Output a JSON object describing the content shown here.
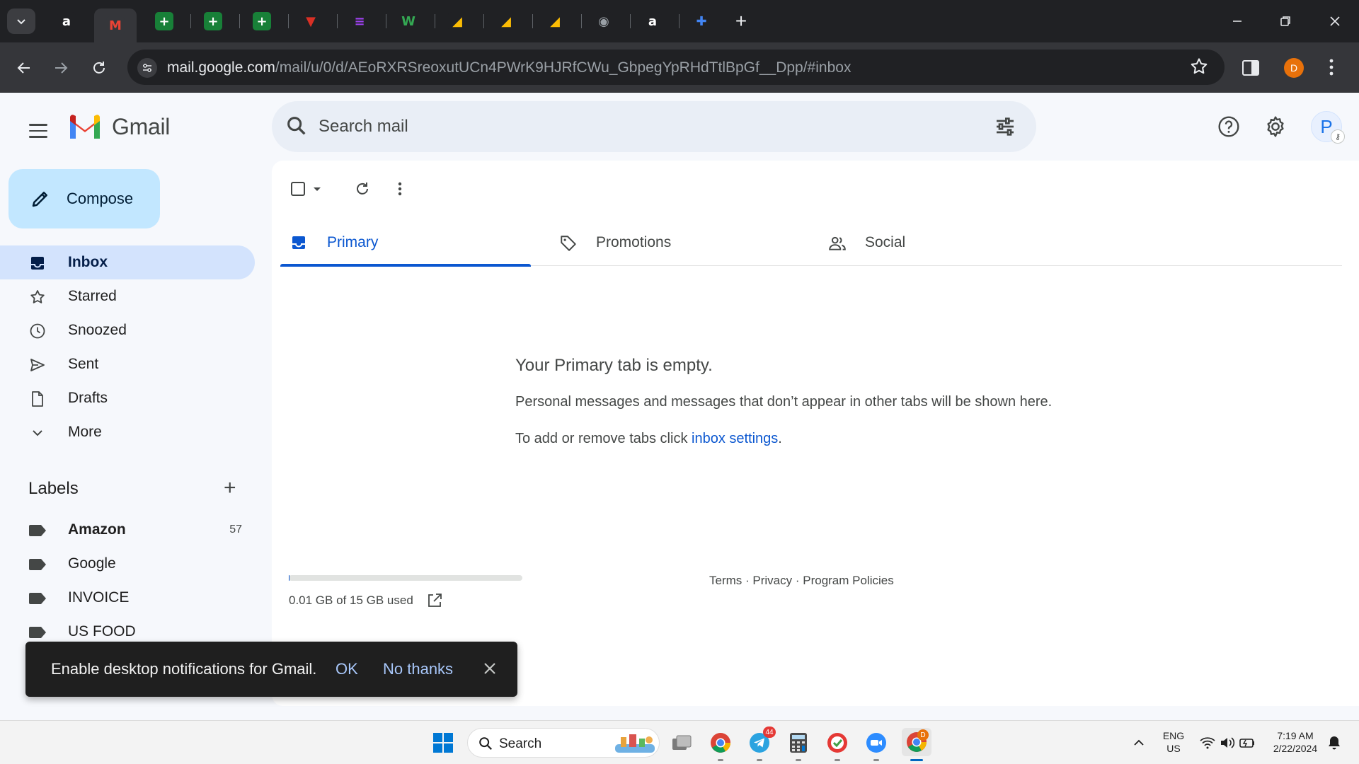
{
  "browser": {
    "tabs": [
      {
        "name": "amazon",
        "glyph": "a",
        "bg": "#202124",
        "color": "#ffffff"
      },
      {
        "name": "gmail",
        "glyph": "M",
        "bg": "#35363a",
        "color": "#ea4335"
      },
      {
        "name": "sheets-1",
        "glyph": "+",
        "bg": "#188038",
        "color": "#ffffff"
      },
      {
        "name": "sheets-2",
        "glyph": "+",
        "bg": "#188038",
        "color": "#ffffff"
      },
      {
        "name": "sheets-3",
        "glyph": "+",
        "bg": "#188038",
        "color": "#ffffff"
      },
      {
        "name": "red-logo",
        "glyph": "▼",
        "bg": "#202124",
        "color": "#d93025"
      },
      {
        "name": "purple-logo",
        "glyph": "≡",
        "bg": "#202124",
        "color": "#a142f4"
      },
      {
        "name": "w-app",
        "glyph": "W",
        "bg": "#202124",
        "color": "#34a853"
      },
      {
        "name": "slides-1",
        "glyph": "◢",
        "bg": "#202124",
        "color": "#fbbc04"
      },
      {
        "name": "slides-2",
        "glyph": "◢",
        "bg": "#202124",
        "color": "#fbbc04"
      },
      {
        "name": "slides-3",
        "glyph": "◢",
        "bg": "#202124",
        "color": "#fbbc04"
      },
      {
        "name": "globe",
        "glyph": "◉",
        "bg": "#202124",
        "color": "#9aa0a6"
      },
      {
        "name": "amazon-2",
        "glyph": "a",
        "bg": "#202124",
        "color": "#ffffff"
      },
      {
        "name": "blue-plus",
        "glyph": "✚",
        "bg": "#202124",
        "color": "#4285f4"
      }
    ],
    "url_host": "mail.google.com",
    "url_path": "/mail/u/0/d/AEoRXRSreoxutUCn4PWrK9HJRfCWu_GbpegYpRHdTtlBpGf__Dpp/#inbox",
    "profile_initial": "D"
  },
  "gmail": {
    "wordmark": "Gmail",
    "search_placeholder": "Search mail",
    "avatar_initial": "P",
    "compose_label": "Compose",
    "nav": [
      {
        "label": "Inbox",
        "icon": "inbox-icon",
        "active": true
      },
      {
        "label": "Starred",
        "icon": "star-icon"
      },
      {
        "label": "Snoozed",
        "icon": "clock-icon"
      },
      {
        "label": "Sent",
        "icon": "send-icon"
      },
      {
        "label": "Drafts",
        "icon": "draft-icon"
      },
      {
        "label": "More",
        "icon": "chevron-down-icon"
      }
    ],
    "labels_title": "Labels",
    "labels": [
      {
        "label": "Amazon",
        "count": "57",
        "bold": true
      },
      {
        "label": "Google",
        "count": ""
      },
      {
        "label": "INVOICE",
        "count": ""
      },
      {
        "label": "US FOOD",
        "count": ""
      }
    ],
    "tabs": [
      {
        "label": "Primary",
        "icon": "inbox-tab-icon",
        "active": true
      },
      {
        "label": "Promotions",
        "icon": "tag-icon"
      },
      {
        "label": "Social",
        "icon": "people-icon"
      }
    ],
    "empty": {
      "title": "Your Primary tab is empty.",
      "line1": "Personal messages and messages that don’t appear in other tabs will be shown here.",
      "line2_prefix": "To add or remove tabs click ",
      "line2_link": "inbox settings",
      "line2_suffix": "."
    },
    "storage": {
      "text": "0.01 GB of 15 GB used",
      "fraction": 0.0007
    },
    "footer": {
      "terms": "Terms",
      "privacy": "Privacy",
      "policies": "Program Policies",
      "sep": " · "
    },
    "toast": {
      "message": "Enable desktop notifications for Gmail.",
      "ok": "OK",
      "no_thanks": "No thanks"
    }
  },
  "taskbar": {
    "search_label": "Search",
    "telegram_badge": "44",
    "chrome_badge": "D",
    "lang_1": "ENG",
    "lang_2": "US",
    "time": "7:19 AM",
    "date": "2/22/2024"
  }
}
